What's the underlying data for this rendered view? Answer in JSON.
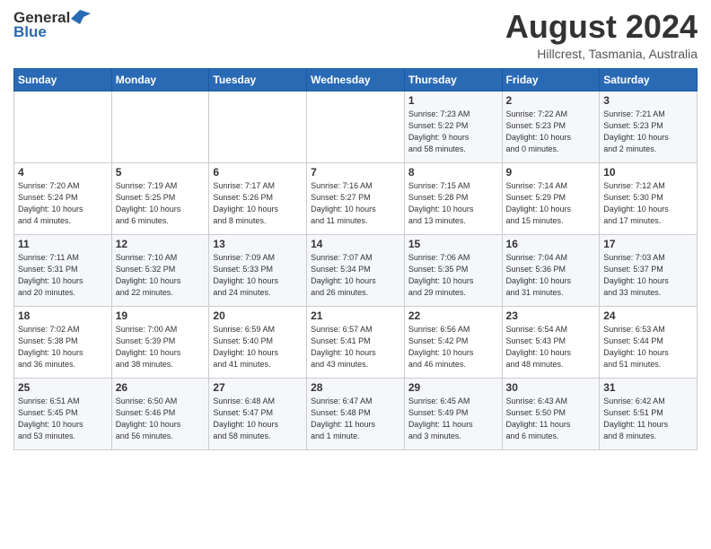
{
  "header": {
    "logo_general": "General",
    "logo_blue": "Blue",
    "month_year": "August 2024",
    "location": "Hillcrest, Tasmania, Australia"
  },
  "days_of_week": [
    "Sunday",
    "Monday",
    "Tuesday",
    "Wednesday",
    "Thursday",
    "Friday",
    "Saturday"
  ],
  "weeks": [
    [
      {
        "day": "",
        "info": ""
      },
      {
        "day": "",
        "info": ""
      },
      {
        "day": "",
        "info": ""
      },
      {
        "day": "",
        "info": ""
      },
      {
        "day": "1",
        "info": "Sunrise: 7:23 AM\nSunset: 5:22 PM\nDaylight: 9 hours\nand 58 minutes."
      },
      {
        "day": "2",
        "info": "Sunrise: 7:22 AM\nSunset: 5:23 PM\nDaylight: 10 hours\nand 0 minutes."
      },
      {
        "day": "3",
        "info": "Sunrise: 7:21 AM\nSunset: 5:23 PM\nDaylight: 10 hours\nand 2 minutes."
      }
    ],
    [
      {
        "day": "4",
        "info": "Sunrise: 7:20 AM\nSunset: 5:24 PM\nDaylight: 10 hours\nand 4 minutes."
      },
      {
        "day": "5",
        "info": "Sunrise: 7:19 AM\nSunset: 5:25 PM\nDaylight: 10 hours\nand 6 minutes."
      },
      {
        "day": "6",
        "info": "Sunrise: 7:17 AM\nSunset: 5:26 PM\nDaylight: 10 hours\nand 8 minutes."
      },
      {
        "day": "7",
        "info": "Sunrise: 7:16 AM\nSunset: 5:27 PM\nDaylight: 10 hours\nand 11 minutes."
      },
      {
        "day": "8",
        "info": "Sunrise: 7:15 AM\nSunset: 5:28 PM\nDaylight: 10 hours\nand 13 minutes."
      },
      {
        "day": "9",
        "info": "Sunrise: 7:14 AM\nSunset: 5:29 PM\nDaylight: 10 hours\nand 15 minutes."
      },
      {
        "day": "10",
        "info": "Sunrise: 7:12 AM\nSunset: 5:30 PM\nDaylight: 10 hours\nand 17 minutes."
      }
    ],
    [
      {
        "day": "11",
        "info": "Sunrise: 7:11 AM\nSunset: 5:31 PM\nDaylight: 10 hours\nand 20 minutes."
      },
      {
        "day": "12",
        "info": "Sunrise: 7:10 AM\nSunset: 5:32 PM\nDaylight: 10 hours\nand 22 minutes."
      },
      {
        "day": "13",
        "info": "Sunrise: 7:09 AM\nSunset: 5:33 PM\nDaylight: 10 hours\nand 24 minutes."
      },
      {
        "day": "14",
        "info": "Sunrise: 7:07 AM\nSunset: 5:34 PM\nDaylight: 10 hours\nand 26 minutes."
      },
      {
        "day": "15",
        "info": "Sunrise: 7:06 AM\nSunset: 5:35 PM\nDaylight: 10 hours\nand 29 minutes."
      },
      {
        "day": "16",
        "info": "Sunrise: 7:04 AM\nSunset: 5:36 PM\nDaylight: 10 hours\nand 31 minutes."
      },
      {
        "day": "17",
        "info": "Sunrise: 7:03 AM\nSunset: 5:37 PM\nDaylight: 10 hours\nand 33 minutes."
      }
    ],
    [
      {
        "day": "18",
        "info": "Sunrise: 7:02 AM\nSunset: 5:38 PM\nDaylight: 10 hours\nand 36 minutes."
      },
      {
        "day": "19",
        "info": "Sunrise: 7:00 AM\nSunset: 5:39 PM\nDaylight: 10 hours\nand 38 minutes."
      },
      {
        "day": "20",
        "info": "Sunrise: 6:59 AM\nSunset: 5:40 PM\nDaylight: 10 hours\nand 41 minutes."
      },
      {
        "day": "21",
        "info": "Sunrise: 6:57 AM\nSunset: 5:41 PM\nDaylight: 10 hours\nand 43 minutes."
      },
      {
        "day": "22",
        "info": "Sunrise: 6:56 AM\nSunset: 5:42 PM\nDaylight: 10 hours\nand 46 minutes."
      },
      {
        "day": "23",
        "info": "Sunrise: 6:54 AM\nSunset: 5:43 PM\nDaylight: 10 hours\nand 48 minutes."
      },
      {
        "day": "24",
        "info": "Sunrise: 6:53 AM\nSunset: 5:44 PM\nDaylight: 10 hours\nand 51 minutes."
      }
    ],
    [
      {
        "day": "25",
        "info": "Sunrise: 6:51 AM\nSunset: 5:45 PM\nDaylight: 10 hours\nand 53 minutes."
      },
      {
        "day": "26",
        "info": "Sunrise: 6:50 AM\nSunset: 5:46 PM\nDaylight: 10 hours\nand 56 minutes."
      },
      {
        "day": "27",
        "info": "Sunrise: 6:48 AM\nSunset: 5:47 PM\nDaylight: 10 hours\nand 58 minutes."
      },
      {
        "day": "28",
        "info": "Sunrise: 6:47 AM\nSunset: 5:48 PM\nDaylight: 11 hours\nand 1 minute."
      },
      {
        "day": "29",
        "info": "Sunrise: 6:45 AM\nSunset: 5:49 PM\nDaylight: 11 hours\nand 3 minutes."
      },
      {
        "day": "30",
        "info": "Sunrise: 6:43 AM\nSunset: 5:50 PM\nDaylight: 11 hours\nand 6 minutes."
      },
      {
        "day": "31",
        "info": "Sunrise: 6:42 AM\nSunset: 5:51 PM\nDaylight: 11 hours\nand 8 minutes."
      }
    ]
  ]
}
